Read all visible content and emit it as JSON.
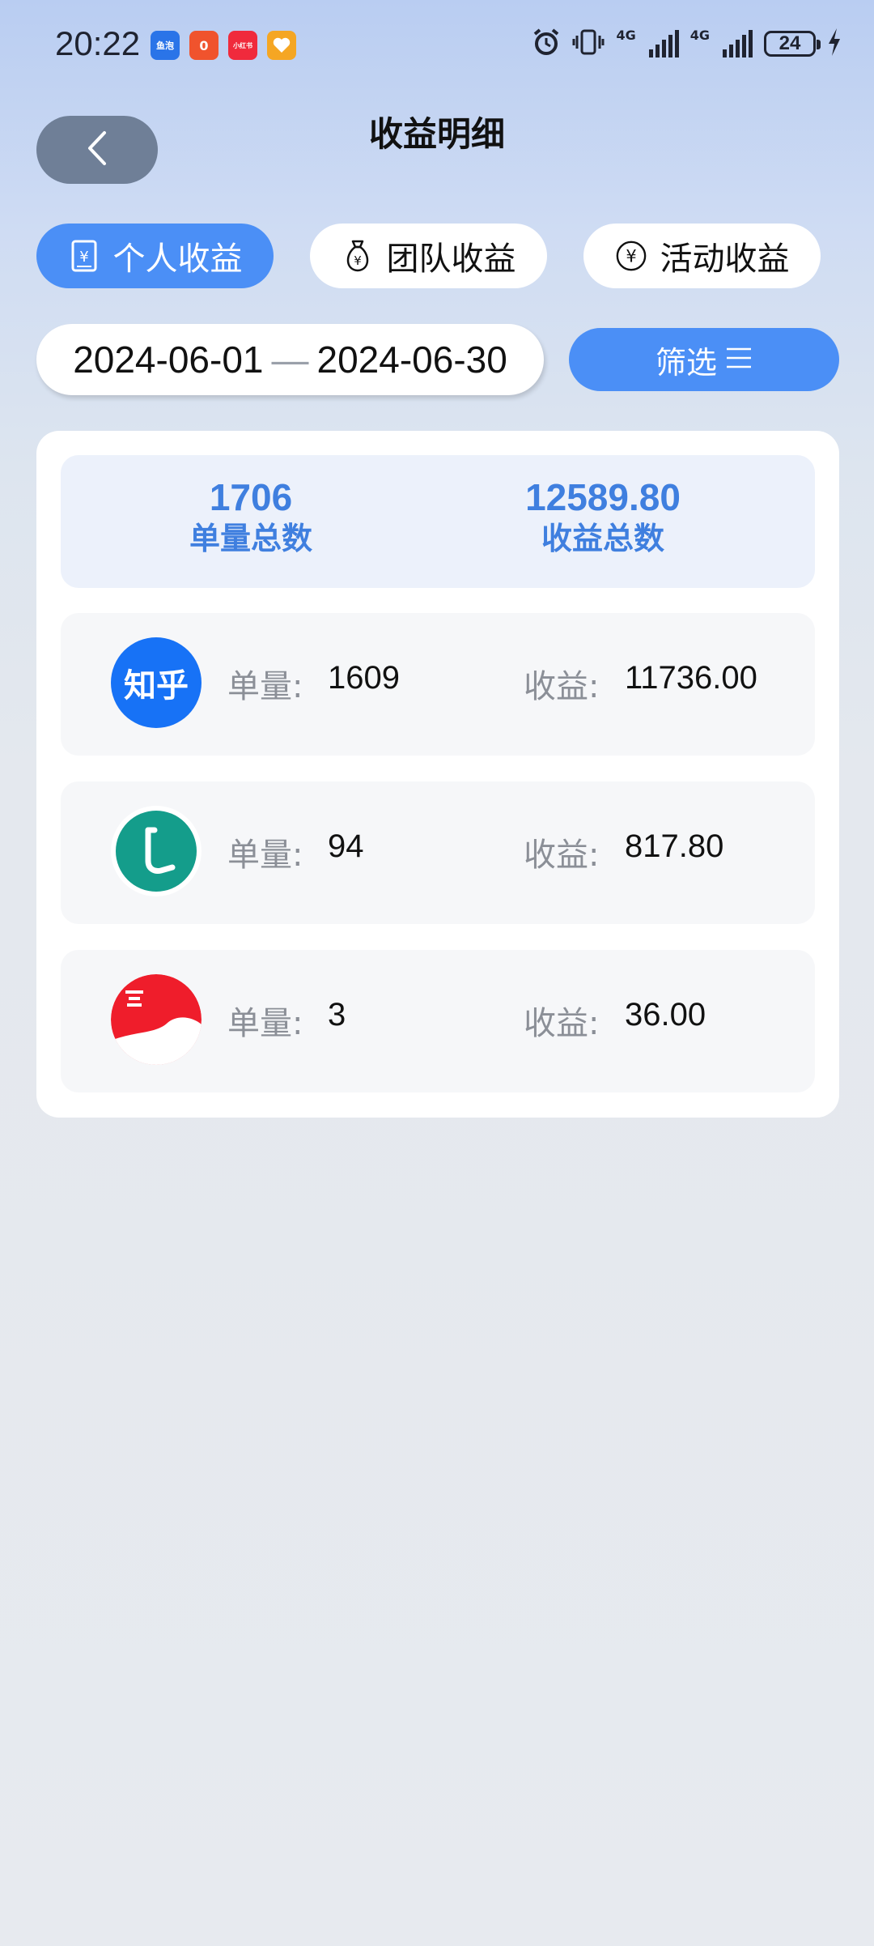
{
  "status_bar": {
    "time": "20:22",
    "notifications": [
      {
        "icon": "fish-app-icon",
        "label": "鱼泡",
        "color": "#2a74e8"
      },
      {
        "icon": "shopping-app-icon",
        "label": "0",
        "color": "#f0532d"
      },
      {
        "icon": "xiaohongshu-icon",
        "label": "小红书",
        "color": "#f02a3c"
      },
      {
        "icon": "heart-app-icon",
        "label": "",
        "color": "#f5a623"
      }
    ],
    "network_1": "4G",
    "network_2": "4G",
    "battery": "24"
  },
  "header": {
    "title": "收益明细"
  },
  "tabs": [
    {
      "label": "个人收益",
      "icon": "receipt-yuan-icon",
      "active": true
    },
    {
      "label": "团队收益",
      "icon": "money-bag-icon",
      "active": false
    },
    {
      "label": "活动收益",
      "icon": "yuan-circle-icon",
      "active": false
    }
  ],
  "date_range": {
    "start": "2024-06-01",
    "separator": "—",
    "end": "2024-06-30"
  },
  "filter": {
    "label": "筛选"
  },
  "summary": {
    "count_value": "1706",
    "count_label": "单量总数",
    "income_value": "12589.80",
    "income_label": "收益总数"
  },
  "rows": [
    {
      "app": "zhihu-logo",
      "logo_text": "知乎",
      "count_label": "单量:",
      "count": "1609",
      "income_label": "收益:",
      "income": "11736.00"
    },
    {
      "app": "green-l-logo",
      "logo_text": "",
      "count_label": "单量:",
      "count": "94",
      "income_label": "收益:",
      "income": "817.80"
    },
    {
      "app": "red-logo",
      "logo_text": "",
      "count_label": "单量:",
      "count": "3",
      "income_label": "收益:",
      "income": "36.00"
    }
  ]
}
